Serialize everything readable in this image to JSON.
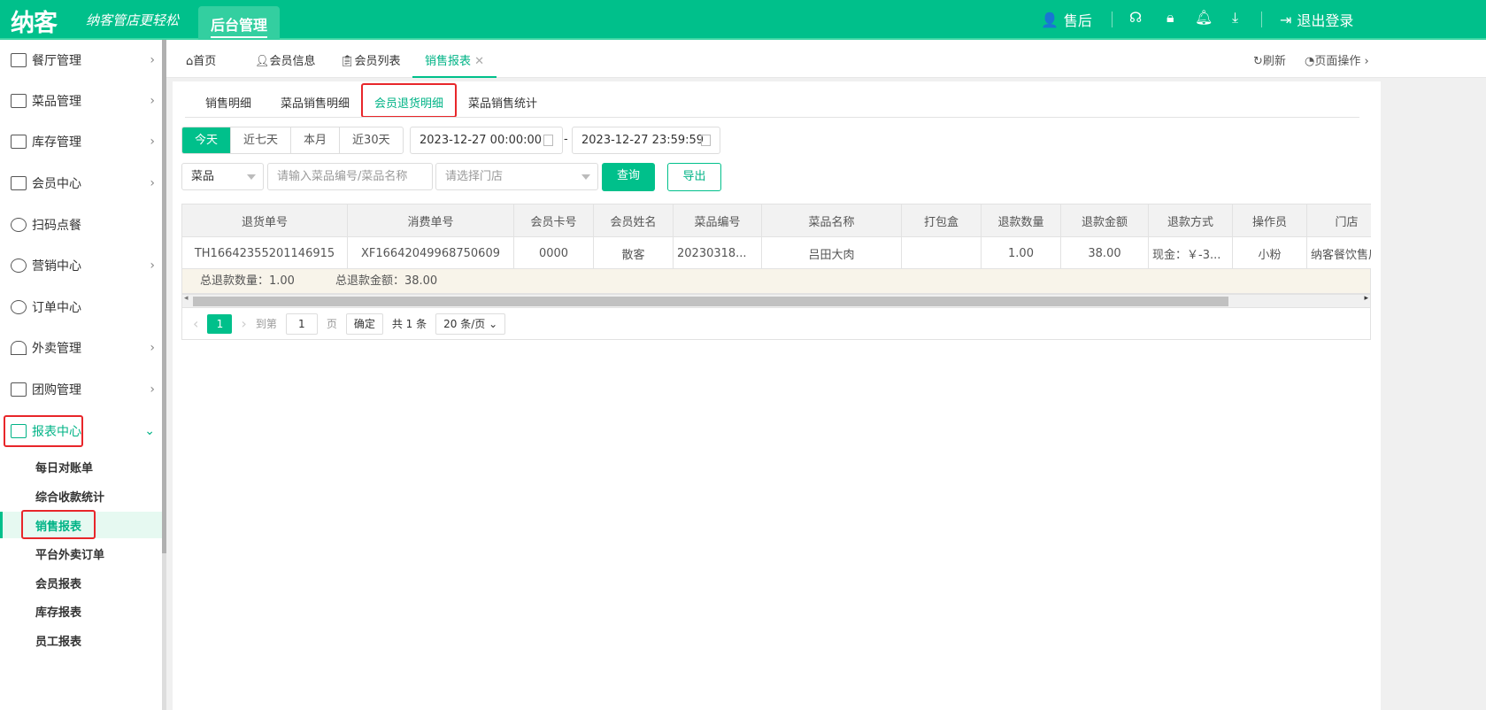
{
  "header": {
    "logo": "纳客",
    "slogan": "纳客管店更轻松",
    "admin_tab": "后台管理",
    "user": "售后",
    "logout": "退出登录",
    "colors": {
      "brand": "#00c08b",
      "highlight": "#e8262a"
    },
    "icons": [
      "user-icon",
      "headset-icon",
      "lock-icon",
      "bell-icon",
      "download-icon",
      "logout-icon"
    ]
  },
  "sidebar": {
    "items": [
      {
        "label": "餐厅管理",
        "chevron": true
      },
      {
        "label": "菜品管理",
        "chevron": true
      },
      {
        "label": "库存管理",
        "chevron": true
      },
      {
        "label": "会员中心",
        "chevron": true
      },
      {
        "label": "扫码点餐",
        "chevron": false
      },
      {
        "label": "营销中心",
        "chevron": true
      },
      {
        "label": "订单中心",
        "chevron": false
      },
      {
        "label": "外卖管理",
        "chevron": true
      },
      {
        "label": "团购管理",
        "chevron": true
      },
      {
        "label": "报表中心",
        "chevron": true,
        "expanded": true
      }
    ],
    "sub_items": [
      "每日对账单",
      "综合收款统计",
      "销售报表",
      "平台外卖订单",
      "会员报表",
      "库存报表",
      "员工报表"
    ],
    "active_sub": "销售报表"
  },
  "tabs": {
    "items": [
      "首页",
      "会员信息",
      "会员列表",
      "销售报表"
    ],
    "active": "销售报表",
    "refresh": "刷新",
    "page_ops": "页面操作"
  },
  "subtabs": {
    "items": [
      "销售明细",
      "菜品销售明细",
      "会员退货明细",
      "菜品销售统计"
    ],
    "active": "会员退货明细"
  },
  "filters": {
    "ranges": [
      "今天",
      "近七天",
      "本月",
      "近30天"
    ],
    "active_range": "今天",
    "start": "2023-12-27 00:00:00",
    "end": "2023-12-27 23:59:59",
    "dash": "-",
    "type_select": "菜品",
    "keyword_placeholder": "请输入菜品编号/菜品名称",
    "store_placeholder": "请选择门店",
    "query": "查询",
    "export": "导出"
  },
  "table": {
    "columns": [
      "退货单号",
      "消费单号",
      "会员卡号",
      "会员姓名",
      "菜品编号",
      "菜品名称",
      "打包盒",
      "退款数量",
      "退款金额",
      "退款方式",
      "操作员",
      "门店"
    ],
    "rows": [
      [
        "TH16642355201146915",
        "XF16642049968750609",
        "0000",
        "散客",
        "20230318...",
        "吕田大肉",
        "",
        "1.00",
        "38.00",
        "现金：￥-3...",
        "小粉",
        "纳客餐饮售后"
      ]
    ],
    "summary": {
      "qty": "总退款数量：1.00",
      "amount": "总退款金额：38.00"
    }
  },
  "pagination": {
    "current": "1",
    "goto_label": "到第",
    "goto_value": "1",
    "page_unit": "页",
    "confirm": "确定",
    "total": "共 1 条",
    "page_size": "20 条/页"
  }
}
